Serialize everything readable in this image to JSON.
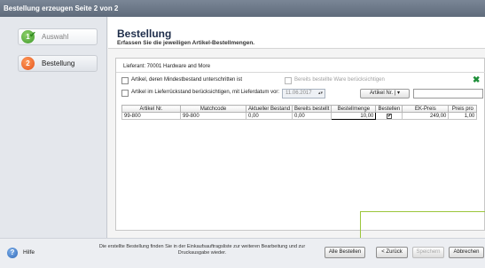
{
  "window": {
    "title": "Bestellung erzeugen Seite 2 von 2"
  },
  "sidebar": {
    "steps": [
      {
        "number": "1",
        "label": "Auswahl",
        "state": "done"
      },
      {
        "number": "2",
        "label": "Bestellung",
        "state": "active"
      }
    ]
  },
  "header": {
    "title": "Bestellung",
    "subtitle": "Erfassen Sie die jeweiligen Artikel-Bestellmengen."
  },
  "panel": {
    "lieferant": "Lieferant: 70001 Hardware and More",
    "opt_mindestbestand": "Artikel, deren Mindestbestand unterschritten ist",
    "opt_bereits_bestellt": "Bereits bestellte Ware berücksichtigen",
    "opt_lieferrueckstand": "Artikel im Lieferrückstand berücksichtigen, mit Lieferdatum vor:",
    "lieferdatum": "11.06.2017",
    "artikel_button": "Artikel Nr.",
    "search_value": ""
  },
  "table": {
    "headers": [
      "Artikel Nr.",
      "Matchcode",
      "Aktueller Bestand",
      "Bereits bestellt",
      "Bestellmenge",
      "Bestellen",
      "EK-Preis",
      "Preis pro"
    ],
    "rows": [
      {
        "artikel_nr": "99-800",
        "matchcode": "99-800",
        "aktueller_bestand": "0,00",
        "bereits_bestellt": "0,00",
        "bestellmenge": "10,00",
        "bestellen": "✔",
        "ek_preis": "249,00",
        "preis_pro": "1,00"
      }
    ]
  },
  "footer": {
    "help": "Hilfe",
    "info": "Die erstellte Bestellung finden Sie in der Einkaufsauftragsliste zur weiteren Bearbeitung und zur Druckausgabe wieder.",
    "btn_alle_bestellen": "Alle Bestellen",
    "btn_zurueck": "< Zurück",
    "btn_speichern": "Speichern",
    "btn_abbrechen": "Abbrechen"
  },
  "colors": {
    "accent_callout": "#9bc63b",
    "step_done": "#3e9a2a",
    "step_active": "#e3531c"
  }
}
